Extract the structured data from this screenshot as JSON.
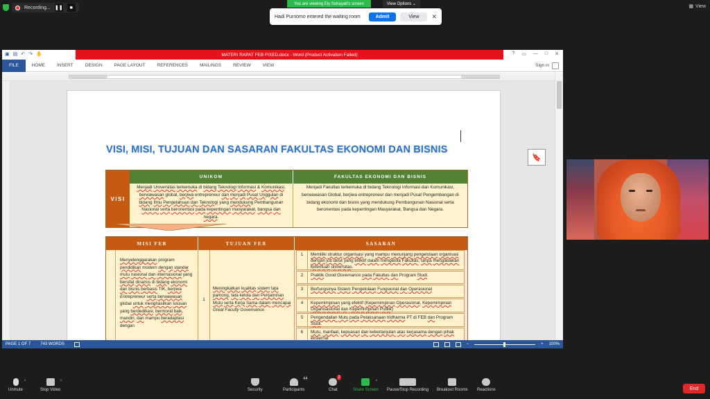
{
  "zoom_top": {
    "recording_label": "Recording...",
    "pause_glyph": "❚❚",
    "stop_glyph": "■",
    "viewing_banner": "You are viewing Ely Suhayati's screen",
    "view_options": "View Options",
    "view_label": "View",
    "waiting": {
      "message": "Hadi Purnomo entered the waiting room",
      "admit_label": "Admit",
      "view_label": "View",
      "close_glyph": "✕"
    }
  },
  "word": {
    "title": "MATERI RAPAT FEB FIXED.docx -  Word (Product Activation Failed)",
    "tabs": [
      "FILE",
      "HOME",
      "INSERT",
      "DESIGN",
      "PAGE LAYOUT",
      "REFERENCES",
      "MAILINGS",
      "REVIEW",
      "VIEW"
    ],
    "sign_in": "Sign in",
    "status": {
      "page": "PAGE 1 OF 7",
      "words": "743 WORDS",
      "zoom": "100%"
    }
  },
  "document": {
    "title": "VISI, MISI, TUJUAN DAN SASARAN FAKULTAS EKONOMI DAN BISNIS",
    "visi_label": "VISI",
    "col_unikom": "UNIKOM",
    "col_feb": "FAKULTAS EKONOMI DAN BISNIS",
    "col_misi": "MISI FEB",
    "col_tujuan": "TUJUAN FEB",
    "col_sasaran": "SASARAN",
    "tujuan_number": "1",
    "sasaran": [
      {
        "n": "1"
      },
      {
        "n": "2"
      },
      {
        "n": "3"
      },
      {
        "n": "4"
      },
      {
        "n": "5"
      },
      {
        "n": "6"
      }
    ]
  },
  "zoom_controls": {
    "unmute": "Unmute",
    "stop_video": "Stop Video",
    "security": "Security",
    "participants": "Participants",
    "participants_count": "44",
    "chat": "Chat",
    "chat_badge": "2",
    "share_screen": "Share Screen",
    "pause_recording": "Pause/Stop Recording",
    "breakout": "Breakout Rooms",
    "reactions": "Reactions",
    "end": "End"
  },
  "colors": {
    "word_blue": "#2b579a",
    "title_red": "#e4131b",
    "zoom_green": "#2dba4e",
    "admit_blue": "#0e72ed",
    "table_orange": "#c55a11",
    "table_green": "#548235",
    "cell_yellow": "#fff2cc",
    "doc_title_blue": "#2e72c8"
  }
}
